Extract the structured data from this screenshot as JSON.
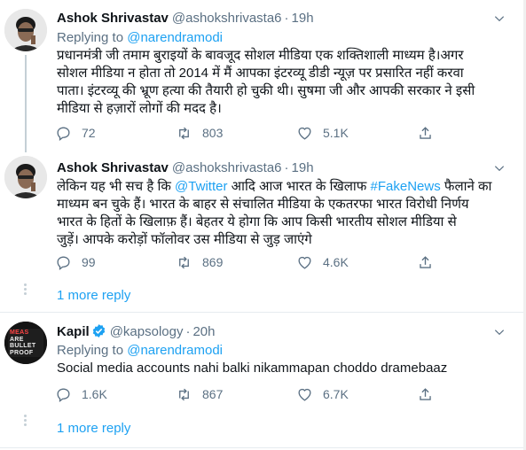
{
  "tweets": [
    {
      "name": "Ashok Shrivastav",
      "handle": "@ashokshrivasta6",
      "dot": "·",
      "time": "19h",
      "replying_prefix": "Replying to ",
      "replying_to": "@narendramodi",
      "lines": [
        "प्रधानमंत्री जी तमाम बुराइयों के बावजूद सोशल मीडिया एक शक्तिशाली माध्यम है।अगर",
        "सोशल मीडिया न होता तो 2014 में मैं आपका इंटरव्यू डीडी न्यूज़ पर प्रसारित नहीं करवा",
        "पाता। इंटरव्यू की भ्रूण हत्या की तैयारी हो चुकी थी। सुषमा जी और आपकी सरकार ने इसी",
        "मीडिया से हज़ारों लोगों की मदद है।"
      ],
      "replies": "72",
      "retweets": "803",
      "likes": "5.1K"
    },
    {
      "name": "Ashok Shrivastav",
      "handle": "@ashokshrivasta6",
      "dot": "·",
      "time": "19h",
      "body_1a": "लेकिन यह भी सच है कि ",
      "body_1_link1": "@Twitter",
      "body_1b": " आदि आज भारत के खिलाफ ",
      "body_1_link2": "#FakeNews",
      "body_1c": " फैलाने का",
      "lines": [
        "माध्यम बन चुके हैं। भारत के बाहर से संचालित मीडिया के एकतरफा भारत विरोधी निर्णय",
        "भारत के हितों  के खिलाफ़ हैं। बेहतर ये होगा कि आप किसी भारतीय सोशल मीडिया से",
        "जुड़ें। आपके करोड़ों फॉलोवर उस मीडिया से जुड़ जाएंगे"
      ],
      "replies": "99",
      "retweets": "869",
      "likes": "4.6K"
    },
    {
      "name": "Kapil",
      "handle": "@kapsology",
      "dot": "·",
      "time": "20h",
      "replying_prefix": "Replying to ",
      "replying_to": "@narendramodi",
      "lines": [
        "Social media accounts nahi balki nikammapan choddo dramebaaz"
      ],
      "replies": "1.6K",
      "retweets": "867",
      "likes": "6.7K",
      "avatar_text": [
        "MEAS",
        "ARE",
        "BULLET",
        "PROOF"
      ]
    }
  ],
  "more_replies_label": "1 more reply",
  "colors": {
    "accent": "#1da1f2",
    "secondary_text": "#5b7083",
    "verified": "#1da1f2"
  }
}
